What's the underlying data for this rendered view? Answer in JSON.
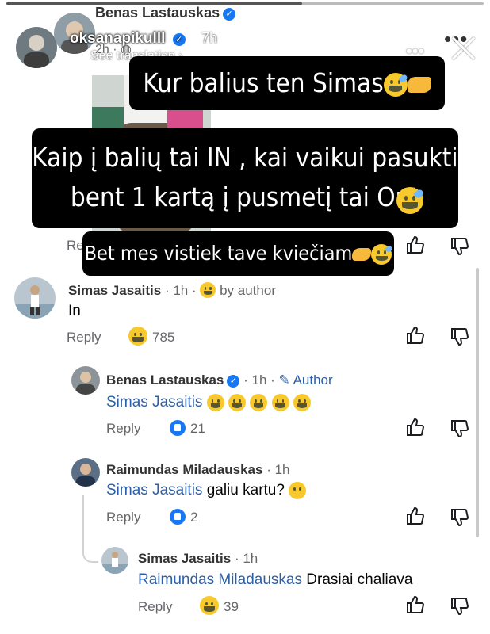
{
  "story": {
    "username": "oksanapikulll",
    "time": "7h",
    "progress": 0.62
  },
  "post": {
    "author": "Benas Lastauskas",
    "time": "2h",
    "see_translation": "See translation",
    "reply_label": "Re"
  },
  "stickers": {
    "line1": "Kur balius ten Simas",
    "line2": "Kaip į balių tai IN , kai vaikui pasukti\nbent 1 kartą į pusmetį tai Out",
    "line3": "Bet mes vistiek tave kviečiam"
  },
  "comments": [
    {
      "name": "Simas Jasaitis",
      "time": "1h",
      "tag": "by author",
      "text": "In",
      "reply": "Reply",
      "reactions": "785"
    },
    {
      "name": "Benas Lastauskas",
      "time": "1h",
      "tag": "Author",
      "mention": "Simas Jasaitis",
      "text": "",
      "reply": "Reply",
      "reactions": "21"
    },
    {
      "name": "Raimundas Miladauskas",
      "time": "1h",
      "mention": "Simas Jasaitis",
      "text": "galiu kartu?",
      "reply": "Reply",
      "reactions": "2"
    },
    {
      "name": "Simas Jasaitis",
      "time": "1h",
      "mention": "Raimundas Miladauskas",
      "text": "Drasiai chaliava",
      "reply": "Reply",
      "reactions": "39"
    }
  ],
  "colors": {
    "mention": "#2c5fa8",
    "like_blue": "#1877f2",
    "sticker_bg": "#000000"
  }
}
